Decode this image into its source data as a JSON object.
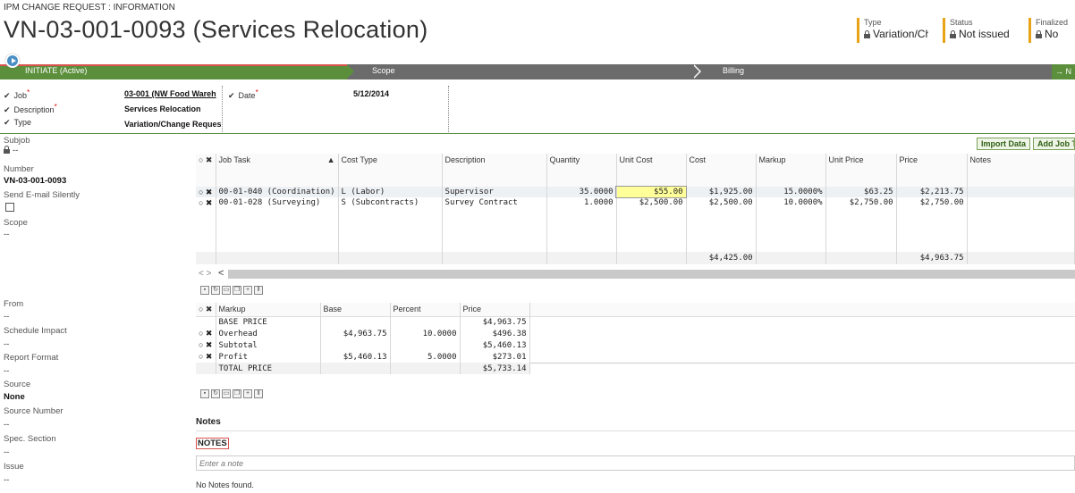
{
  "header": {
    "breadcrumb": "IPM CHANGE REQUEST : INFORMATION",
    "title": "VN-03-001-0093 (Services Relocation)",
    "fields": [
      {
        "label": "Type",
        "value": "Variation/Cha"
      },
      {
        "label": "Status",
        "value": "Not issued"
      },
      {
        "label": "Finalized",
        "value": "No"
      }
    ]
  },
  "workflow": {
    "stages": [
      {
        "label": "INITIATE (Active)"
      },
      {
        "label": "Scope"
      },
      {
        "label": "Billing"
      }
    ],
    "next_label": "→ N"
  },
  "form": {
    "job_label": "Job",
    "job_value": "03-001 (NW Food Wareh",
    "description_label": "Description",
    "description_value": "Services Relocation",
    "type_label": "Type",
    "type_value": "Variation/Change Reques",
    "date_label": "Date",
    "date_value": "5/12/2014"
  },
  "sidebar": {
    "subjob_label": "Subjob",
    "subjob_value": "--",
    "number_label": "Number",
    "number_value": "VN-03-001-0093",
    "email_label": "Send E-mail Silently",
    "scope_label": "Scope",
    "scope_value": "--",
    "from_label": "From",
    "from_value": "--",
    "schedule_label": "Schedule Impact",
    "schedule_value": "--",
    "report_label": "Report Format",
    "report_value": "--",
    "source_label": "Source",
    "source_value": "None",
    "source_number_label": "Source Number",
    "source_number_value": "--",
    "spec_label": "Spec. Section",
    "spec_value": "--",
    "issue_label": "Issue",
    "issue_value": "--"
  },
  "buttons": {
    "import": "Import Data",
    "add_job": "Add Job T"
  },
  "cost_grid": {
    "headers": [
      "Job Task",
      "Cost Type",
      "Description",
      "Quantity",
      "Unit Cost",
      "Cost",
      "Markup",
      "Unit Price",
      "Price",
      "Notes"
    ],
    "rows": [
      [
        "00-01-040 (Coordination)",
        "L (Labor)",
        "Supervisor",
        "35.0000",
        "$55.00",
        "$1,925.00",
        "15.0000%",
        "$63.25",
        "$2,213.75",
        ""
      ],
      [
        "00-01-028 (Surveying)",
        "S (Subcontracts)",
        "Survey Contract",
        "1.0000",
        "$2,500.00",
        "$2,500.00",
        "10.0000%",
        "$2,750.00",
        "$2,750.00",
        ""
      ]
    ],
    "total_cost": "$4,425.00",
    "total_price": "$4,963.75"
  },
  "markup_grid": {
    "headers": [
      "Markup",
      "Base",
      "Percent",
      "Price"
    ],
    "rows": [
      {
        "ox": false,
        "cells": [
          "BASE PRICE",
          "",
          "",
          "$4,963.75"
        ]
      },
      {
        "ox": true,
        "cells": [
          "Overhead",
          "$4,963.75",
          "10.0000",
          "$496.38"
        ]
      },
      {
        "ox": true,
        "cells": [
          "Subtotal",
          "",
          "",
          "$5,460.13"
        ]
      },
      {
        "ox": true,
        "cells": [
          "Profit",
          "$5,460.13",
          "5.0000",
          "$273.01"
        ]
      },
      {
        "ox": false,
        "cells": [
          "TOTAL PRICE",
          "",
          "",
          "$5,733.14"
        ]
      }
    ]
  },
  "notes": {
    "section_title": "Notes",
    "tab_label": "NOTES",
    "placeholder": "Enter a note",
    "empty_text": "No Notes found."
  }
}
